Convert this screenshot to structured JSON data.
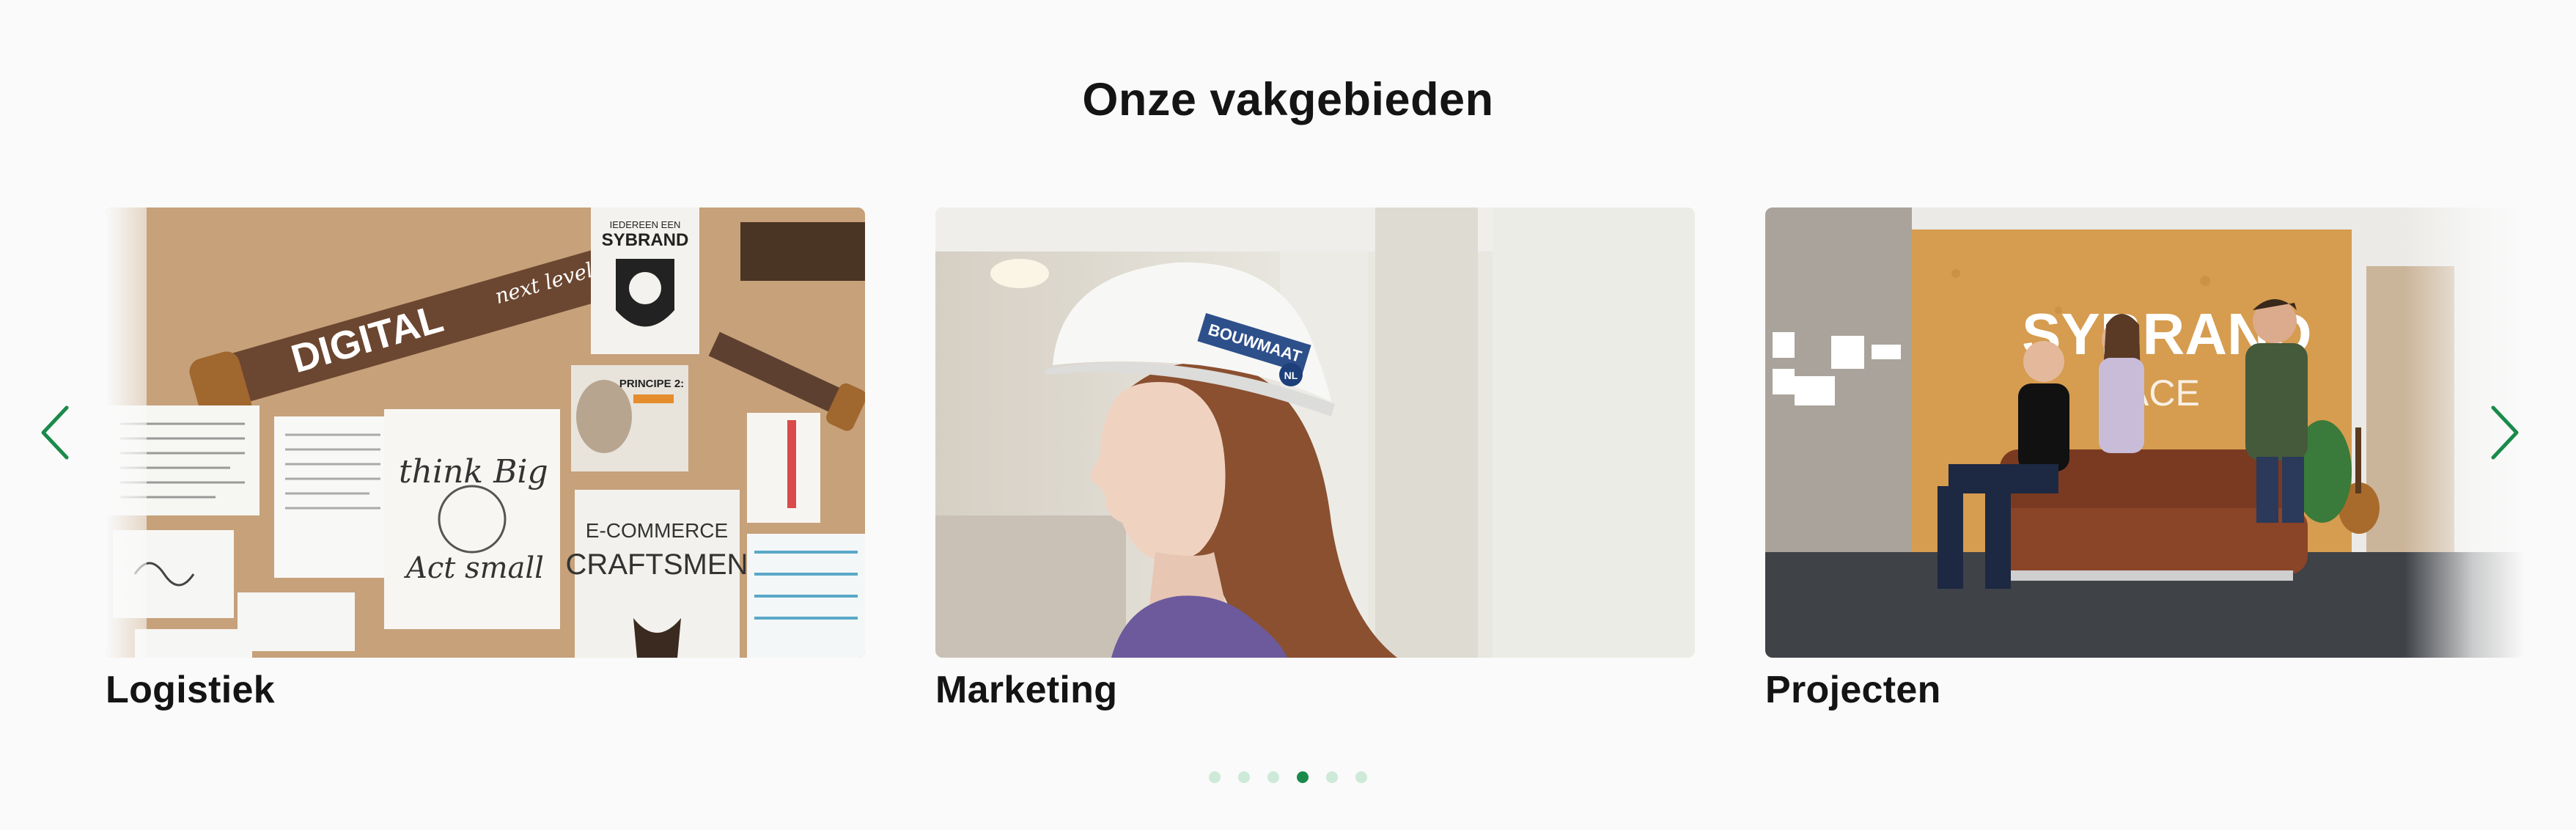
{
  "section": {
    "title": "Onze vakgebieden"
  },
  "cards": [
    {
      "label": "Logistiek",
      "image": "office-wall-photo"
    },
    {
      "label": "Marketing",
      "image": "woman-hard-hat-photo"
    },
    {
      "label": "Projecten",
      "image": "team-on-sofa-photo"
    }
  ],
  "photo_text": {
    "saw": "DIGITAL",
    "saw_small": "next level",
    "poster_top": "IEDEREEN EEN",
    "poster_brand": "SYBRAND",
    "note": "PRINCIPE 2:",
    "think": "think Big",
    "act": "Act small",
    "ecommerce": "E-COMMERCE",
    "craftsmen": "CRAFTSMEN",
    "helmet": "BOUWMAAT",
    "helmet_badge": "NL",
    "wall_brand": "SYBRAND",
    "wall_sub": "ACE"
  },
  "navigation": {
    "prev_icon": "chevron-left-icon",
    "next_icon": "chevron-right-icon"
  },
  "pagination": {
    "count": 6,
    "active_index": 3
  },
  "colors": {
    "accent": "#1a8a4a",
    "dot_inactive": "#cde9d8",
    "text": "#141414",
    "background": "#fafafa"
  }
}
